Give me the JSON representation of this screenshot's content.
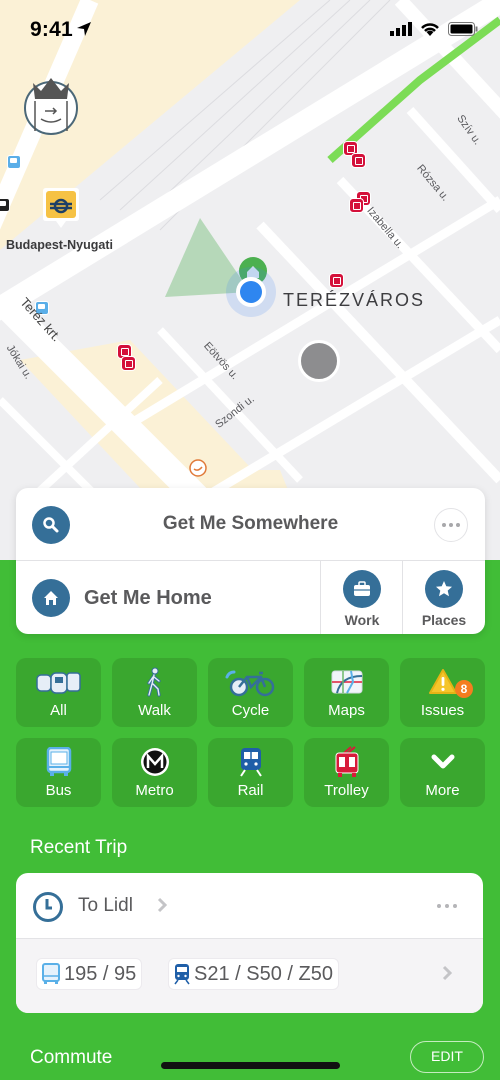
{
  "status_bar": {
    "time": "9:41",
    "icons": [
      "location-arrow-icon",
      "signal-icon",
      "wifi-icon",
      "battery-icon"
    ]
  },
  "map": {
    "district_label": "TERÉZVÁROS",
    "station_label": "Budapest-Nyugati",
    "street_labels": [
      "Teréz krt.",
      "Jókai u.",
      "Eötvös u.",
      "Szondi u.",
      "Izabella u.",
      "Rózsa u.",
      "Szív u."
    ],
    "markers": [
      "user-location",
      "home-pin",
      "rail-station-pin",
      "tram-stop",
      "bus-stop",
      "grey-place-marker"
    ]
  },
  "search_card": {
    "search_label": "Get Me Somewhere",
    "home_label": "Get Me Home",
    "work_label": "Work",
    "places_label": "Places"
  },
  "modes": [
    {
      "label": "All",
      "icon": "all-transit-icon"
    },
    {
      "label": "Walk",
      "icon": "walk-icon"
    },
    {
      "label": "Cycle",
      "icon": "bicycle-icon"
    },
    {
      "label": "Maps",
      "icon": "transit-map-icon"
    },
    {
      "label": "Issues",
      "icon": "warning-icon",
      "badge": "8"
    },
    {
      "label": "Bus",
      "icon": "bus-icon"
    },
    {
      "label": "Metro",
      "icon": "metro-icon"
    },
    {
      "label": "Rail",
      "icon": "train-icon"
    },
    {
      "label": "Trolley",
      "icon": "trolleybus-icon"
    },
    {
      "label": "More",
      "icon": "chevron-down-icon"
    }
  ],
  "recent_trip": {
    "section_title": "Recent Trip",
    "destination": "To Lidl",
    "routes": [
      {
        "mode": "bus",
        "lines": "195 / 95"
      },
      {
        "mode": "rail",
        "lines": "S21 / S50 / Z50"
      }
    ]
  },
  "commute": {
    "section_title": "Commute",
    "edit_label": "EDIT"
  },
  "colors": {
    "brand_green": "#41bd37",
    "tile_green": "#3aa72f",
    "icon_blue": "#356f98",
    "badge_orange": "#f57d20",
    "tram_red": "#d4103a"
  }
}
